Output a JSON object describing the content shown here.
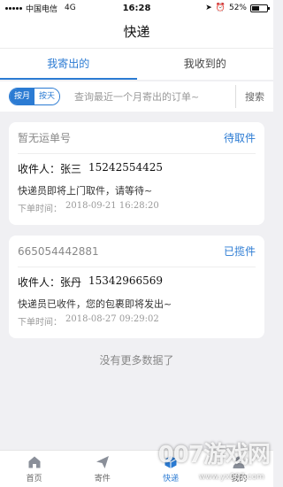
{
  "status_bar": {
    "carrier": "中国电信",
    "network": "4G",
    "time": "16:28",
    "battery": "52%"
  },
  "nav": {
    "title": "快递"
  },
  "tabs": [
    {
      "label": "我寄出的",
      "active": true
    },
    {
      "label": "我收到的",
      "active": false
    }
  ],
  "search": {
    "segment": [
      "按月",
      "按天"
    ],
    "hint": "查询最近一个月寄出的订单~",
    "button": "搜索"
  },
  "orders": [
    {
      "order_no": "暂无运单号",
      "status": "待取件",
      "recipient_label": "收件人：",
      "recipient_name": "张三",
      "phone": "15242554425",
      "message": "快递员即将上门取件，请等待~",
      "time_label": "下单时间：",
      "time": "2018-09-21 16:28:20"
    },
    {
      "order_no": "665054442881",
      "status": "已揽件",
      "recipient_label": "收件人：",
      "recipient_name": "张丹",
      "phone": "15342966569",
      "message": "快递员已收件，您的包裹即将发出~",
      "time_label": "下单时间：",
      "time": "2018-08-27 09:29:02"
    }
  ],
  "footer_text": "没有更多数据了",
  "tabbar": [
    {
      "label": "首页",
      "icon": "home-icon"
    },
    {
      "label": "寄件",
      "icon": "send-icon"
    },
    {
      "label": "快递",
      "icon": "box-icon",
      "active": true
    },
    {
      "label": "我的",
      "icon": "user-icon"
    }
  ],
  "watermark": {
    "text": "007游戏网",
    "url": "www.yx007.com"
  },
  "colors": {
    "accent": "#2b7bd3",
    "background": "#f0f0f3"
  }
}
